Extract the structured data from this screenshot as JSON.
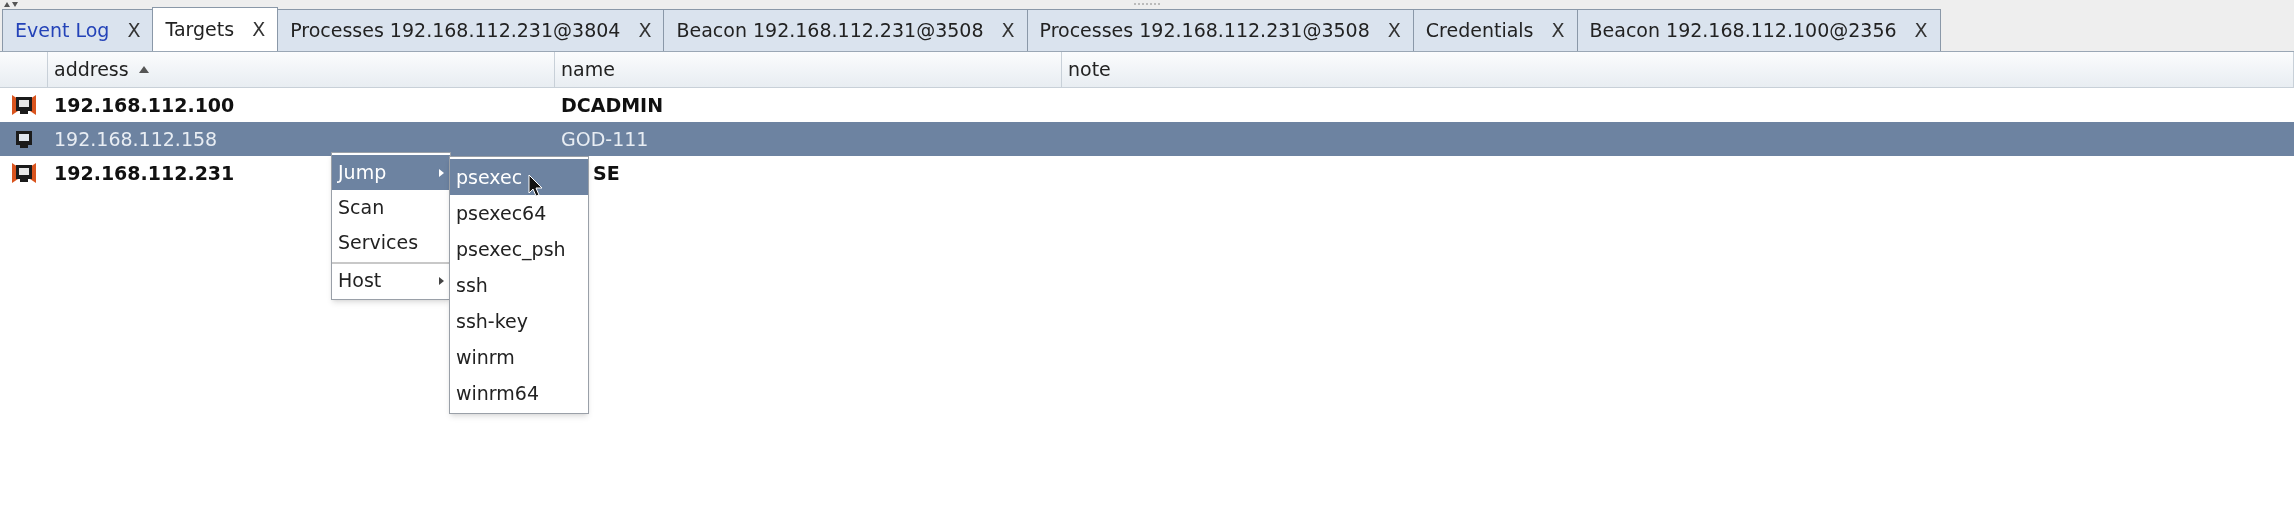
{
  "tabs": [
    {
      "label": "Event Log",
      "selected": false,
      "highlighted": true,
      "close": "X"
    },
    {
      "label": "Targets",
      "selected": true,
      "highlighted": false,
      "close": "X"
    },
    {
      "label": "Processes 192.168.112.231@3804",
      "selected": false,
      "highlighted": false,
      "close": "X"
    },
    {
      "label": "Beacon 192.168.112.231@3508",
      "selected": false,
      "highlighted": false,
      "close": "X"
    },
    {
      "label": "Processes 192.168.112.231@3508",
      "selected": false,
      "highlighted": false,
      "close": "X"
    },
    {
      "label": "Credentials",
      "selected": false,
      "highlighted": false,
      "close": "X"
    },
    {
      "label": "Beacon 192.168.112.100@2356",
      "selected": false,
      "highlighted": false,
      "close": "X"
    }
  ],
  "table": {
    "columns": [
      {
        "label": "address",
        "sorted": true
      },
      {
        "label": "name",
        "sorted": false
      },
      {
        "label": "note",
        "sorted": false
      }
    ],
    "rows": [
      {
        "address": "192.168.112.100",
        "name": "DCADMIN",
        "selected": false,
        "has_session": true,
        "name_partly_hidden": false
      },
      {
        "address": "192.168.112.158",
        "name": "GOD-111",
        "selected": true,
        "has_session": false,
        "name_partly_hidden": false
      },
      {
        "address": "192.168.112.231",
        "name": "SE",
        "selected": false,
        "has_session": true,
        "name_partly_hidden": true
      }
    ]
  },
  "context_menu": {
    "items": [
      {
        "label": "Jump",
        "submenu": true,
        "selected": true,
        "separator_before": false
      },
      {
        "label": "Scan",
        "submenu": false,
        "selected": false,
        "separator_before": false
      },
      {
        "label": "Services",
        "submenu": false,
        "selected": false,
        "separator_before": false
      },
      {
        "label": "Host",
        "submenu": true,
        "selected": false,
        "separator_before": true
      }
    ]
  },
  "submenu": {
    "items": [
      {
        "label": "psexec",
        "selected": true
      },
      {
        "label": "psexec64",
        "selected": false
      },
      {
        "label": "psexec_psh",
        "selected": false
      },
      {
        "label": "ssh",
        "selected": false
      },
      {
        "label": "ssh-key",
        "selected": false
      },
      {
        "label": "winrm",
        "selected": false
      },
      {
        "label": "winrm64",
        "selected": false
      }
    ]
  }
}
